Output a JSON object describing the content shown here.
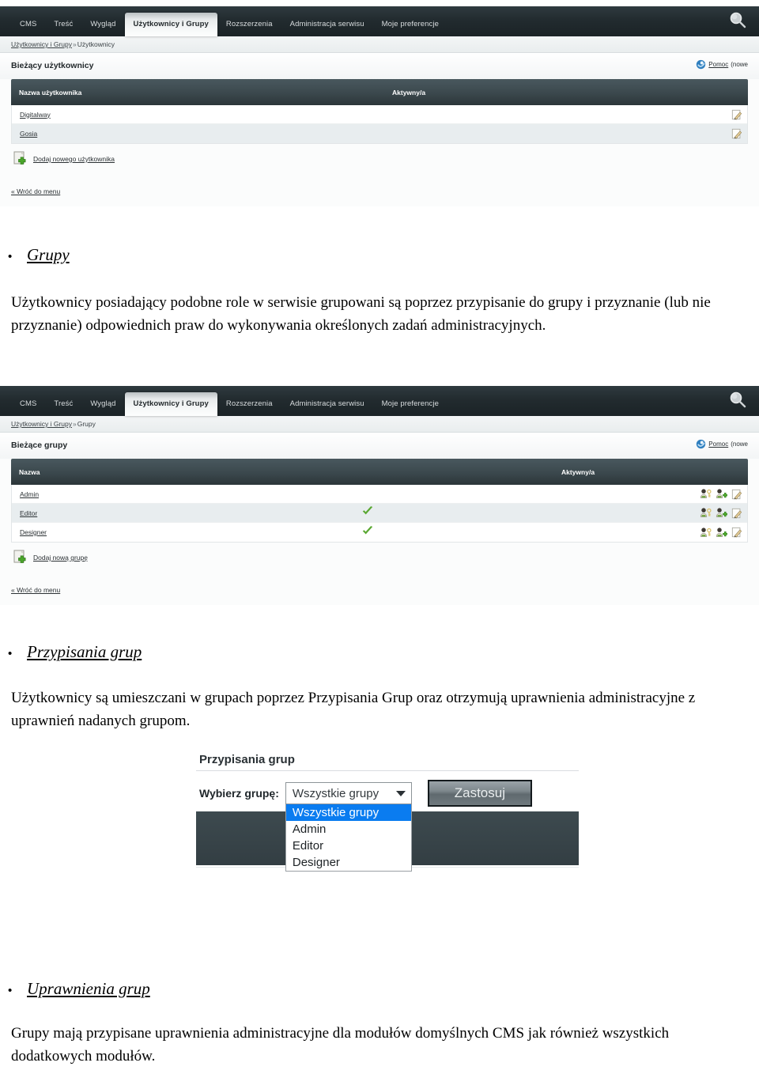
{
  "cms_nav": {
    "tabs": [
      {
        "label": "CMS",
        "active": false
      },
      {
        "label": "Treść",
        "active": false
      },
      {
        "label": "Wygląd",
        "active": false
      },
      {
        "label": "Użytkownicy i Grupy",
        "active": true
      },
      {
        "label": "Rozszerzenia",
        "active": false
      },
      {
        "label": "Administracja serwisu",
        "active": false
      },
      {
        "label": "Moje preferencje",
        "active": false
      }
    ],
    "search_icon": "search-icon"
  },
  "users_screen": {
    "breadcrumb_link": "Użytkownicy i Grupy",
    "breadcrumb_sep": "»",
    "breadcrumb_current": "Użytkownicy",
    "title": "Bieżący użytkownicy",
    "help_label": "Pomoc",
    "help_tail": "(nowe",
    "help_icon": "help-icon",
    "columns": [
      "Nazwa użytkownika",
      "Aktywny/a"
    ],
    "rows": [
      {
        "name": "Digitalway",
        "active": false,
        "actions": [
          "edit-icon"
        ]
      },
      {
        "name": "Gosia",
        "active": false,
        "actions": [
          "edit-icon"
        ]
      }
    ],
    "add_label": "Dodaj nowego użytkownika",
    "add_icon": "add-page-icon",
    "back_label": "« Wróć do menu"
  },
  "groups_screen": {
    "breadcrumb_link": "Użytkownicy i Grupy",
    "breadcrumb_sep": "»",
    "breadcrumb_current": "Grupy",
    "title": "Bieżące grupy",
    "help_label": "Pomoc",
    "help_tail": "(nowe",
    "help_icon": "help-icon",
    "columns": [
      "Nazwa",
      "Aktywny/a"
    ],
    "rows": [
      {
        "name": "Admin",
        "active": false,
        "actions": [
          "user-permissions-icon",
          "user-add-icon",
          "edit-icon"
        ]
      },
      {
        "name": "Editor",
        "active": true,
        "actions": [
          "user-permissions-icon",
          "user-add-icon",
          "edit-icon"
        ]
      },
      {
        "name": "Designer",
        "active": true,
        "actions": [
          "user-permissions-icon",
          "user-add-icon",
          "edit-icon"
        ]
      }
    ],
    "add_label": "Dodaj nową grupę",
    "add_icon": "add-page-icon",
    "back_label": "« Wróć do menu"
  },
  "sections": [
    {
      "bullet": "•",
      "heading": "Grupy",
      "paragraph": "Użytkownicy posiadający podobne role w serwisie grupowani są   poprzez przypisanie do grupy i przyznanie (lub nie przyznanie) odpowiednich praw do wykonywania określonych zadań administracyjnych."
    },
    {
      "bullet": "•",
      "heading": "Przypisania grup",
      "paragraph": "Użytkownicy są umieszczani w grupach poprzez Przypisania Grup oraz otrzymują uprawnienia administracyjne z uprawnień nadanych grupom."
    },
    {
      "bullet": "•",
      "heading": "Uprawnienia grup",
      "paragraph": "Grupy mają przypisane uprawnienia administracyjne dla modułów domyślnych CMS jak również wszystkich dodatkowych modułów."
    }
  ],
  "assignments_screen": {
    "title": "Przypisania grup",
    "select_label": "Wybierz grupę:",
    "selected_value": "Wszystkie grupy",
    "options": [
      "Wszystkie grupy",
      "Admin",
      "Editor",
      "Designer"
    ],
    "selected_index": 0,
    "apply_button": "Zastosuj",
    "caret_icon": "chevron-down-icon"
  },
  "colors": {
    "nav_dark": "#222b2f",
    "table_header": "#3b484d",
    "row_alt": "#e8edef",
    "accent_green": "#5aa832",
    "select_highlight": "#0a7cf0"
  }
}
